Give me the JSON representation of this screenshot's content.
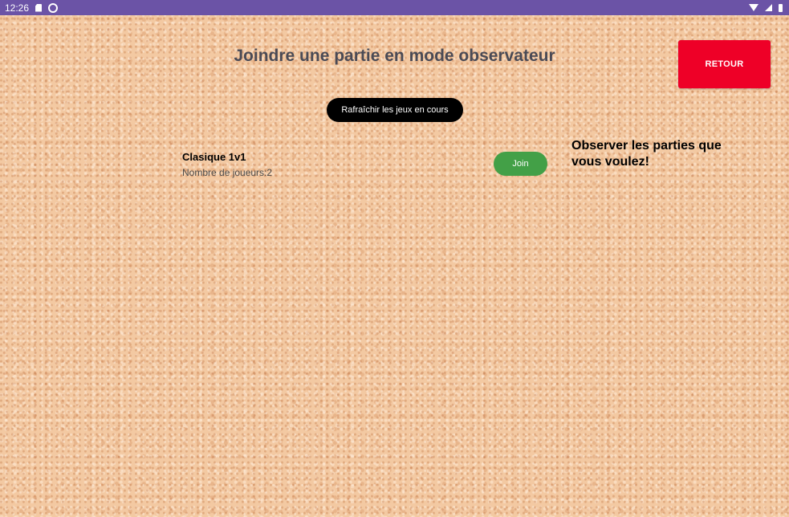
{
  "status_bar": {
    "time": "12:26",
    "icons_left": [
      "sd-card-icon",
      "sync-icon"
    ],
    "icons_right": [
      "wifi-icon",
      "signal-icon",
      "battery-icon"
    ]
  },
  "colors": {
    "status_bar": "#6b53a6",
    "back_button": "#ee0027",
    "refresh_button": "#000000",
    "join_button": "#43a047",
    "title": "#4a4a55"
  },
  "header": {
    "title": "Joindre une partie en mode observateur",
    "back_label": "RETOUR"
  },
  "toolbar": {
    "refresh_label": "Rafraîchir les jeux en cours"
  },
  "games": [
    {
      "name": "Clasique 1v1",
      "players_label": "Nombre de joueurs:",
      "players_count": "2",
      "join_label": "Join"
    }
  ],
  "side_hint": "Observer les parties que vous voulez!"
}
